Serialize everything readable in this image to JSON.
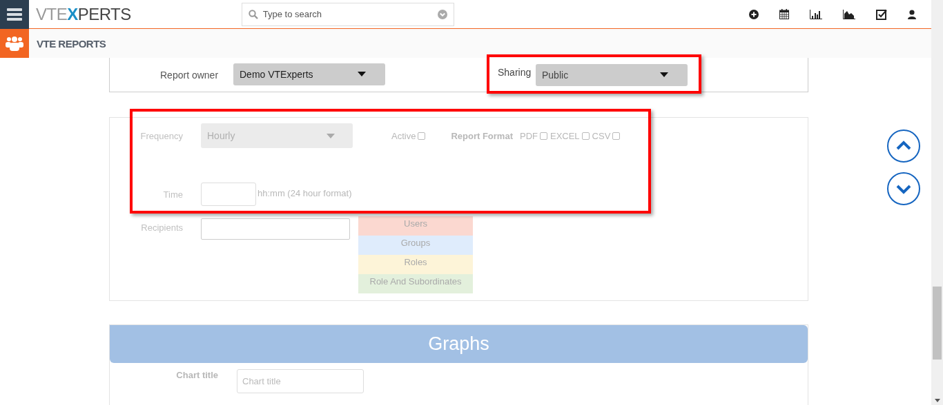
{
  "header": {
    "logo": [
      {
        "text": "VTE",
        "accent": false
      },
      {
        "text": "X",
        "accent": true
      },
      {
        "text": "PERTS",
        "accent": false
      }
    ],
    "search": {
      "placeholder": "Type to search"
    }
  },
  "subheader": {
    "title": "VTE REPORTS"
  },
  "owner_row": {
    "owner_label": "Report owner",
    "owner_value": "Demo VTExperts",
    "sharing_label": "Sharing",
    "sharing_value": "Public"
  },
  "schedule": {
    "frequency_label": "Frequency",
    "frequency_value": "Hourly",
    "active_label": "Active",
    "active_checked": false,
    "format_label": "Report Format",
    "formats": [
      {
        "label": "PDF",
        "checked": false
      },
      {
        "label": "EXCEL",
        "checked": false
      },
      {
        "label": "CSV",
        "checked": false
      }
    ],
    "time_label": "Time",
    "time_hint": "hh:mm (24 hour format)",
    "recipients_label": "Recipients",
    "recipient_types": [
      {
        "label": "Users",
        "color": "#fbd8d0"
      },
      {
        "label": "Groups",
        "color": "#dfecfc"
      },
      {
        "label": "Roles",
        "color": "#fdf4d8"
      },
      {
        "label": "Role And Subordinates",
        "color": "#e3f0dc"
      }
    ]
  },
  "graphs": {
    "title": "Graphs",
    "chart_title_label": "Chart title",
    "chart_title_placeholder": "Chart title"
  }
}
